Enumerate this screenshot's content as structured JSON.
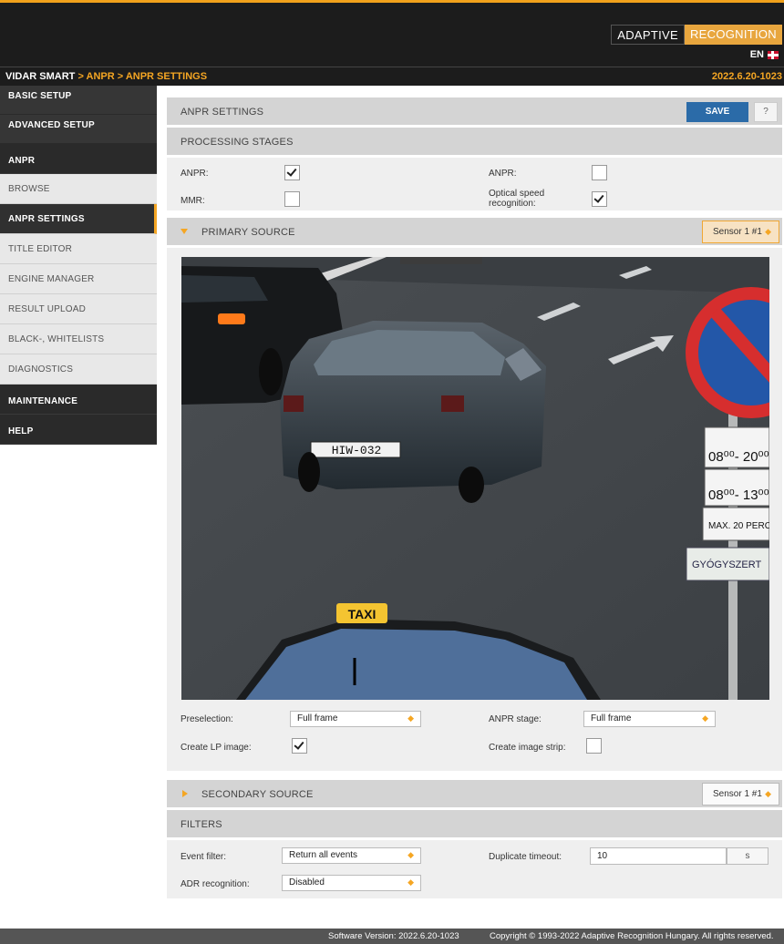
{
  "brand": {
    "part1": "ADAPTIVE",
    "part2": "RECOGNITION"
  },
  "lang": "EN",
  "breadcrumb": {
    "root": "VIDAR SMART",
    "rest": " > ANPR > ANPR SETTINGS"
  },
  "version": "2022.6.20-1023",
  "sidebar": {
    "items": [
      {
        "label": "BASIC SETUP"
      },
      {
        "label": "ADVANCED SETUP"
      },
      {
        "label": "ANPR"
      },
      {
        "label": "BROWSE"
      },
      {
        "label": "ANPR SETTINGS"
      },
      {
        "label": "TITLE EDITOR"
      },
      {
        "label": "ENGINE MANAGER"
      },
      {
        "label": "RESULT UPLOAD"
      },
      {
        "label": "BLACK-, WHITELISTS"
      },
      {
        "label": "DIAGNOSTICS"
      },
      {
        "label": "MAINTENANCE"
      },
      {
        "label": "HELP"
      }
    ]
  },
  "anpr_settings": {
    "title": "ANPR SETTINGS",
    "save_label": "SAVE",
    "help_label": "?"
  },
  "processing": {
    "title": "PROCESSING STAGES",
    "anpr_left_label": "ANPR:",
    "anpr_left_checked": true,
    "anpr_right_label": "ANPR:",
    "anpr_right_checked": false,
    "mmr_label": "MMR:",
    "mmr_checked": false,
    "osr_label_1": "Optical speed",
    "osr_label_2": "recognition:",
    "osr_checked": true
  },
  "primary": {
    "title": "PRIMARY SOURCE",
    "sensor": "Sensor 1 #1",
    "preselection_label": "Preselection:",
    "preselection_value": "Full frame",
    "anpr_stage_label": "ANPR stage:",
    "anpr_stage_value": "Full frame",
    "create_lp_label": "Create LP image:",
    "create_lp_checked": true,
    "create_strip_label": "Create image strip:",
    "create_strip_checked": false,
    "camera": {
      "plate": "HIW-032",
      "taxi": "TAXI",
      "sign_hours_1": "08⁰⁰- 20⁰⁰",
      "sign_hours_2": "08⁰⁰- 13⁰⁰",
      "sign_max": "MAX. 20 PERC",
      "sign_shop": "GYÓGYSZERT"
    }
  },
  "secondary": {
    "title": "SECONDARY SOURCE",
    "sensor": "Sensor 1 #1"
  },
  "filters": {
    "title": "FILTERS",
    "event_label": "Event filter:",
    "event_value": "Return all events",
    "duplicate_label": "Duplicate timeout:",
    "duplicate_value": "10",
    "duplicate_unit": "s",
    "adr_label": "ADR recognition:",
    "adr_value": "Disabled"
  },
  "footer": {
    "software_version": "Software Version:   2022.6.20-1023",
    "copyright": "Copyright © 1993-2022 Adaptive Recognition Hungary. All rights reserved."
  }
}
